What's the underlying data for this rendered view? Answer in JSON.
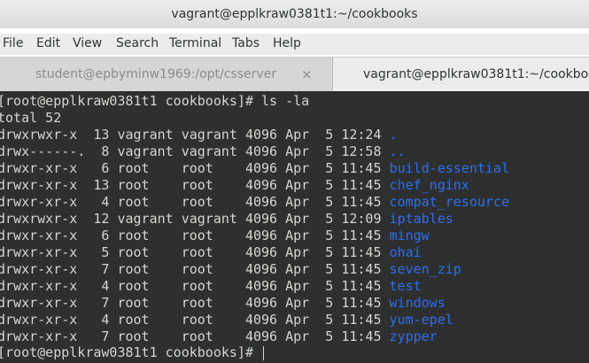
{
  "window": {
    "title": "vagrant@epplkraw0381t1:~/cookbooks"
  },
  "menu": [
    "File",
    "Edit",
    "View",
    "Search",
    "Terminal",
    "Tabs",
    "Help"
  ],
  "tabs": [
    {
      "label": "student@epbyminw1969:/opt/csserver",
      "close": "×",
      "active": false
    },
    {
      "label": "vagrant@epplkraw0381t1:~/cookbooks",
      "active": true
    }
  ],
  "terminal": {
    "prompt_cmd": "[root@epplkraw0381t1 cookbooks]# ls -la",
    "total": "total 52",
    "entries": [
      {
        "meta": "drwxrwxr-x  13 vagrant vagrant 4096 Apr  5 12:24 ",
        "name": "."
      },
      {
        "meta": "drwx------.  8 vagrant vagrant 4096 Apr  5 12:58 ",
        "name": ".."
      },
      {
        "meta": "drwxr-xr-x   6 root    root    4096 Apr  5 11:45 ",
        "name": "build-essential"
      },
      {
        "meta": "drwxr-xr-x  13 root    root    4096 Apr  5 11:45 ",
        "name": "chef_nginx"
      },
      {
        "meta": "drwxr-xr-x   4 root    root    4096 Apr  5 11:45 ",
        "name": "compat_resource"
      },
      {
        "meta": "drwxrwxr-x  12 vagrant vagrant 4096 Apr  5 12:09 ",
        "name": "iptables"
      },
      {
        "meta": "drwxr-xr-x   6 root    root    4096 Apr  5 11:45 ",
        "name": "mingw"
      },
      {
        "meta": "drwxr-xr-x   5 root    root    4096 Apr  5 11:45 ",
        "name": "ohai"
      },
      {
        "meta": "drwxr-xr-x   7 root    root    4096 Apr  5 11:45 ",
        "name": "seven_zip"
      },
      {
        "meta": "drwxr-xr-x   4 root    root    4096 Apr  5 11:45 ",
        "name": "test"
      },
      {
        "meta": "drwxr-xr-x   7 root    root    4096 Apr  5 11:45 ",
        "name": "windows"
      },
      {
        "meta": "drwxr-xr-x   4 root    root    4096 Apr  5 11:45 ",
        "name": "yum-epel"
      },
      {
        "meta": "drwxr-xr-x   7 root    root    4096 Apr  5 11:45 ",
        "name": "zypper"
      }
    ],
    "prompt_end": "[root@epplkraw0381t1 cookbooks]# "
  },
  "colors": {
    "terminal_bg": "#2e2f2f",
    "terminal_fg": "#d3d7cf",
    "directory": "#2a6ff0"
  }
}
